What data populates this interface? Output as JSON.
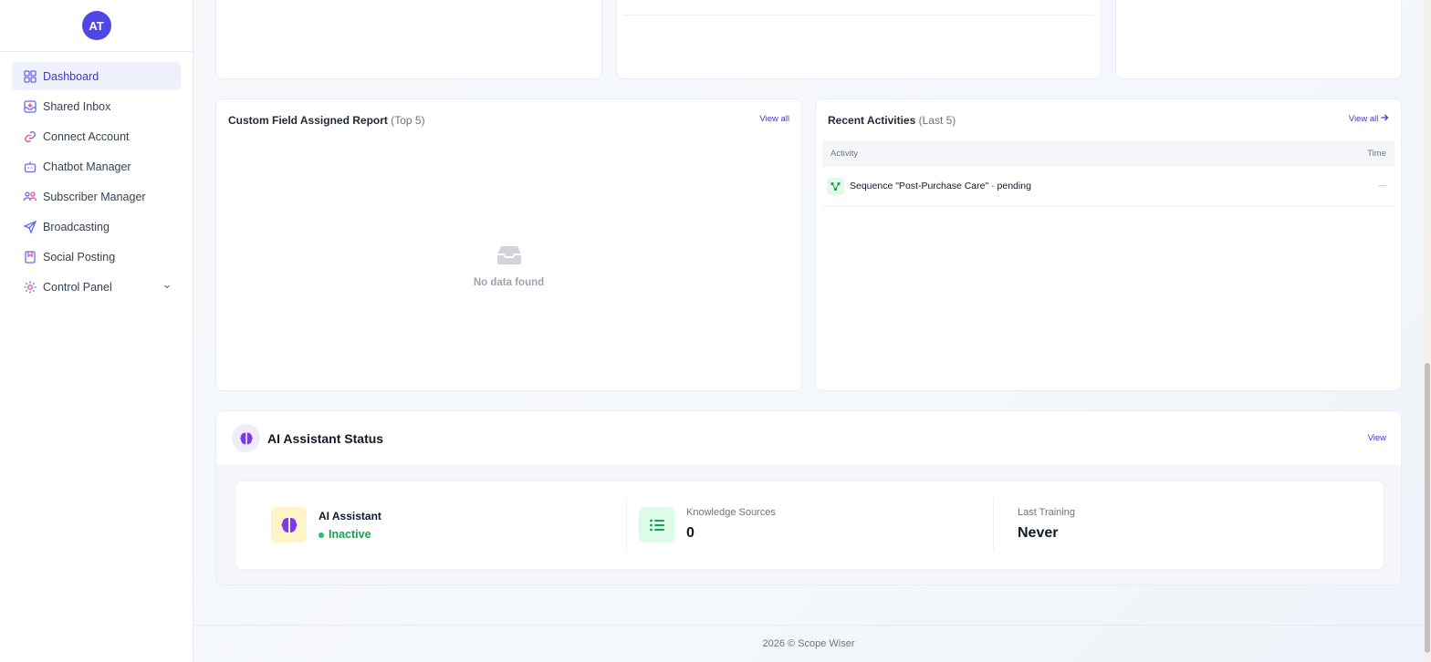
{
  "user": {
    "initials": "AT"
  },
  "sidebar": {
    "items": [
      {
        "label": "Dashboard",
        "icon": "dashboard-grid-icon",
        "active": true
      },
      {
        "label": "Shared Inbox",
        "icon": "inbox-icon"
      },
      {
        "label": "Connect Account",
        "icon": "link-icon"
      },
      {
        "label": "Chatbot Manager",
        "icon": "bot-icon"
      },
      {
        "label": "Subscriber Manager",
        "icon": "users-icon"
      },
      {
        "label": "Broadcasting",
        "icon": "send-icon"
      },
      {
        "label": "Social Posting",
        "icon": "bookmark-icon"
      },
      {
        "label": "Control Panel",
        "icon": "gear-icon",
        "expandable": true
      }
    ]
  },
  "custom_field_report": {
    "title": "Custom Field Assigned Report",
    "subtitle": "(Top 5)",
    "view_all": "View all",
    "empty_text": "No data found"
  },
  "recent_activities": {
    "title": "Recent Activities",
    "subtitle": "(Last 5)",
    "view_all": "View all",
    "columns": {
      "activity": "Activity",
      "time": "Time"
    },
    "rows": [
      {
        "activity": "Sequence \"Post-Purchase Care\" · pending",
        "time": "—"
      }
    ]
  },
  "ai_status": {
    "title": "AI Assistant Status",
    "view_label": "View",
    "assistant": {
      "label": "AI Assistant",
      "status": "Inactive"
    },
    "knowledge": {
      "label": "Knowledge Sources",
      "value": "0"
    },
    "training": {
      "label": "Last Training",
      "value": "Never"
    }
  },
  "footer": {
    "text": "2026 © Scope Wiser"
  },
  "colors": {
    "accent": "#4f46e5",
    "status_inactive": "#22c55e"
  }
}
